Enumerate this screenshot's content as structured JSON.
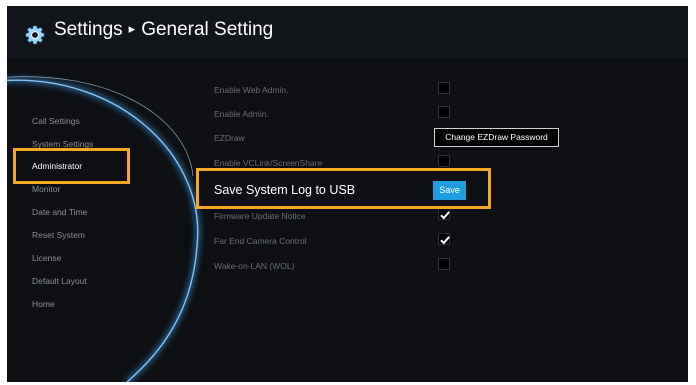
{
  "header": {
    "icon": "gear-icon",
    "title": "Settings",
    "separator": "▸",
    "page": "General Setting"
  },
  "sidebar": {
    "items": [
      {
        "label": "Call Settings",
        "active": false
      },
      {
        "label": "System Settings",
        "active": false
      },
      {
        "label": "Administrator",
        "active": true
      },
      {
        "label": "Monitor",
        "active": false
      },
      {
        "label": "Date and Time",
        "active": false
      },
      {
        "label": "Reset System",
        "active": false
      },
      {
        "label": "License",
        "active": false
      },
      {
        "label": "Default Layout",
        "active": false
      },
      {
        "label": "Home",
        "active": false
      }
    ]
  },
  "options": [
    {
      "label": "Enable Web Admin.",
      "checked": false
    },
    {
      "label": "Enable Admin.",
      "checked": false
    },
    {
      "label": "EZDraw",
      "button": "Change EZDraw Password"
    },
    {
      "label": "Enable VCLink/ScreenShare",
      "checked": false
    },
    {
      "label": "Save System Log to USB",
      "button": "Save"
    },
    {
      "label": "Firmware Update Notice",
      "checked": true
    },
    {
      "label": "Far End Camera Control",
      "checked": true
    },
    {
      "label": "Wake-on-LAN (WOL)",
      "checked": false
    }
  ],
  "colors": {
    "highlight": "#f5a623",
    "accent": "#1e9de0",
    "glow": "#4aa8e8"
  }
}
